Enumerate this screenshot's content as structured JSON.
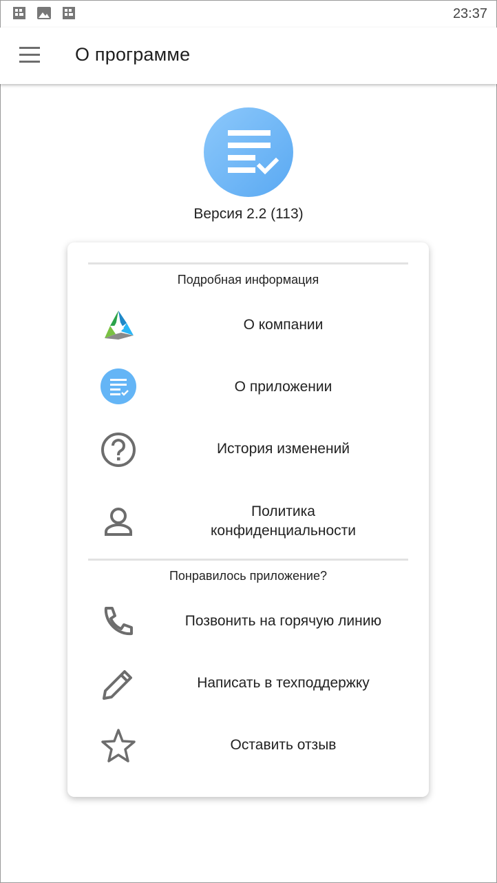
{
  "status_bar": {
    "time": "23:37",
    "icons": [
      "sim-card-icon",
      "image-icon",
      "sim-card-icon"
    ]
  },
  "app_bar": {
    "menu_icon": "hamburger-menu-icon",
    "title": "О программе"
  },
  "app_info": {
    "logo_icon": "app-logo-checklist-icon",
    "version": "Версия 2.2 (113)"
  },
  "card": {
    "details_section": {
      "title": "Подробная информация",
      "items": [
        {
          "icon": "company-logo-icon",
          "label": "О компании"
        },
        {
          "icon": "app-checklist-icon",
          "label": "О приложении"
        },
        {
          "icon": "question-circle-icon",
          "label": "История изменений"
        },
        {
          "icon": "person-icon",
          "label": "Политика\nконфиденциальности"
        }
      ]
    },
    "feedback_section": {
      "title": "Понравилось приложение?",
      "items": [
        {
          "icon": "phone-icon",
          "label": "Позвонить на горячую линию"
        },
        {
          "icon": "pencil-icon",
          "label": "Написать в техподдержку"
        },
        {
          "icon": "star-icon",
          "label": "Оставить отзыв"
        }
      ]
    }
  },
  "colors": {
    "accent_blue": "#64b5f6",
    "icon_gray": "#6d6d6d",
    "divider": "#e2e2e2"
  }
}
